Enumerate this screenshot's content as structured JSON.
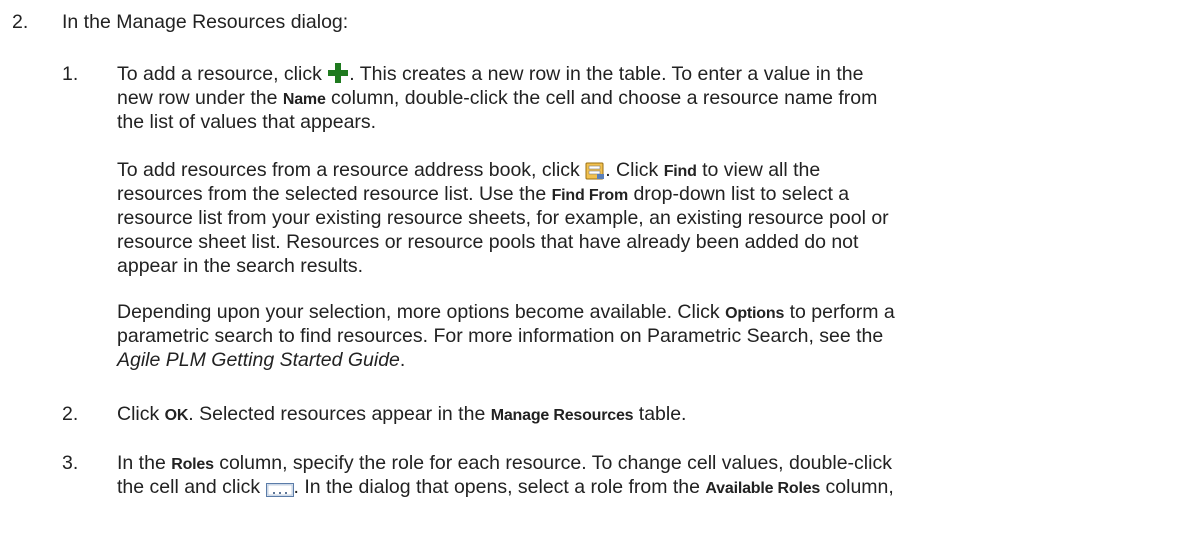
{
  "step2": {
    "number": "2.",
    "intro": "In the Manage Resources dialog:"
  },
  "sub1": {
    "number": "1.",
    "p1_l1a": "To add a resource, click ",
    "p1_l1b": ". This creates a new row in the table. To enter a value in the",
    "p1_l2a": "new row under the ",
    "p1_l2_bold": "Name",
    "p1_l2b": " column, double-click the cell and choose a resource name from",
    "p1_l3": "the list of values that appears.",
    "p2_l1a": "To add resources from a resource address book, click ",
    "p2_l1b": ". Click ",
    "p2_l1_bold": "Find",
    "p2_l1c": " to view all the",
    "p2_l2a": "resources from the selected resource list. Use the ",
    "p2_l2_bold": "Find From",
    "p2_l2b": " drop-down list to select a",
    "p2_l3": "resource list from your existing resource sheets, for example, an existing resource pool or",
    "p2_l4": "resource sheet list. Resources or resource pools that have already been added do not",
    "p2_l5": "appear in the search results.",
    "p3_l1a": "Depending upon your selection, more options become available. Click ",
    "p3_l1_bold": "Options",
    "p3_l1b": " to perform a",
    "p3_l2": "parametric search to find resources. For more information on Parametric Search, see the",
    "p3_l3_italic": "Agile PLM Getting Started Guide",
    "p3_l3b": "."
  },
  "sub2": {
    "number": "2.",
    "a": "Click ",
    "bold1": "OK",
    "b": ". Selected resources appear in the ",
    "bold2": "Manage Resources",
    "c": " table."
  },
  "sub3": {
    "number": "3.",
    "l1a": "In the ",
    "l1_bold": "Roles",
    "l1b": " column, specify the role for each resource. To change cell values, double-click",
    "l2a": "the cell and click ",
    "l2b": ". In the dialog that opens, select a role from the ",
    "l2_bold": "Available Roles",
    "l2c": " column,"
  },
  "icons": {
    "add": "plus-icon",
    "address_book": "address-book-icon",
    "ellipsis": "ellipsis-button-icon"
  },
  "colors": {
    "add_icon": "#1f7a1f"
  }
}
